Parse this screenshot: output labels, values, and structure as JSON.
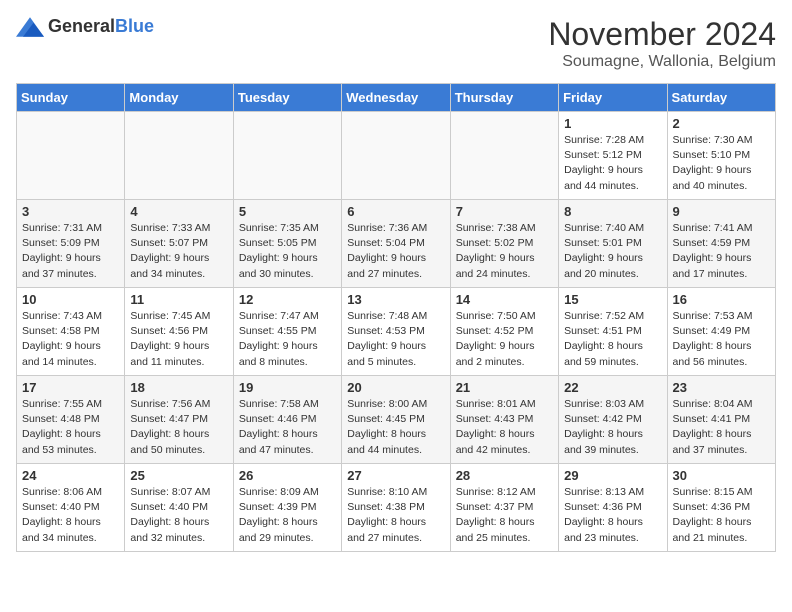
{
  "logo": {
    "text_general": "General",
    "text_blue": "Blue"
  },
  "title": "November 2024",
  "subtitle": "Soumagne, Wallonia, Belgium",
  "days_of_week": [
    "Sunday",
    "Monday",
    "Tuesday",
    "Wednesday",
    "Thursday",
    "Friday",
    "Saturday"
  ],
  "weeks": [
    [
      {
        "day": "",
        "info": ""
      },
      {
        "day": "",
        "info": ""
      },
      {
        "day": "",
        "info": ""
      },
      {
        "day": "",
        "info": ""
      },
      {
        "day": "",
        "info": ""
      },
      {
        "day": "1",
        "info": "Sunrise: 7:28 AM\nSunset: 5:12 PM\nDaylight: 9 hours and 44 minutes."
      },
      {
        "day": "2",
        "info": "Sunrise: 7:30 AM\nSunset: 5:10 PM\nDaylight: 9 hours and 40 minutes."
      }
    ],
    [
      {
        "day": "3",
        "info": "Sunrise: 7:31 AM\nSunset: 5:09 PM\nDaylight: 9 hours and 37 minutes."
      },
      {
        "day": "4",
        "info": "Sunrise: 7:33 AM\nSunset: 5:07 PM\nDaylight: 9 hours and 34 minutes."
      },
      {
        "day": "5",
        "info": "Sunrise: 7:35 AM\nSunset: 5:05 PM\nDaylight: 9 hours and 30 minutes."
      },
      {
        "day": "6",
        "info": "Sunrise: 7:36 AM\nSunset: 5:04 PM\nDaylight: 9 hours and 27 minutes."
      },
      {
        "day": "7",
        "info": "Sunrise: 7:38 AM\nSunset: 5:02 PM\nDaylight: 9 hours and 24 minutes."
      },
      {
        "day": "8",
        "info": "Sunrise: 7:40 AM\nSunset: 5:01 PM\nDaylight: 9 hours and 20 minutes."
      },
      {
        "day": "9",
        "info": "Sunrise: 7:41 AM\nSunset: 4:59 PM\nDaylight: 9 hours and 17 minutes."
      }
    ],
    [
      {
        "day": "10",
        "info": "Sunrise: 7:43 AM\nSunset: 4:58 PM\nDaylight: 9 hours and 14 minutes."
      },
      {
        "day": "11",
        "info": "Sunrise: 7:45 AM\nSunset: 4:56 PM\nDaylight: 9 hours and 11 minutes."
      },
      {
        "day": "12",
        "info": "Sunrise: 7:47 AM\nSunset: 4:55 PM\nDaylight: 9 hours and 8 minutes."
      },
      {
        "day": "13",
        "info": "Sunrise: 7:48 AM\nSunset: 4:53 PM\nDaylight: 9 hours and 5 minutes."
      },
      {
        "day": "14",
        "info": "Sunrise: 7:50 AM\nSunset: 4:52 PM\nDaylight: 9 hours and 2 minutes."
      },
      {
        "day": "15",
        "info": "Sunrise: 7:52 AM\nSunset: 4:51 PM\nDaylight: 8 hours and 59 minutes."
      },
      {
        "day": "16",
        "info": "Sunrise: 7:53 AM\nSunset: 4:49 PM\nDaylight: 8 hours and 56 minutes."
      }
    ],
    [
      {
        "day": "17",
        "info": "Sunrise: 7:55 AM\nSunset: 4:48 PM\nDaylight: 8 hours and 53 minutes."
      },
      {
        "day": "18",
        "info": "Sunrise: 7:56 AM\nSunset: 4:47 PM\nDaylight: 8 hours and 50 minutes."
      },
      {
        "day": "19",
        "info": "Sunrise: 7:58 AM\nSunset: 4:46 PM\nDaylight: 8 hours and 47 minutes."
      },
      {
        "day": "20",
        "info": "Sunrise: 8:00 AM\nSunset: 4:45 PM\nDaylight: 8 hours and 44 minutes."
      },
      {
        "day": "21",
        "info": "Sunrise: 8:01 AM\nSunset: 4:43 PM\nDaylight: 8 hours and 42 minutes."
      },
      {
        "day": "22",
        "info": "Sunrise: 8:03 AM\nSunset: 4:42 PM\nDaylight: 8 hours and 39 minutes."
      },
      {
        "day": "23",
        "info": "Sunrise: 8:04 AM\nSunset: 4:41 PM\nDaylight: 8 hours and 37 minutes."
      }
    ],
    [
      {
        "day": "24",
        "info": "Sunrise: 8:06 AM\nSunset: 4:40 PM\nDaylight: 8 hours and 34 minutes."
      },
      {
        "day": "25",
        "info": "Sunrise: 8:07 AM\nSunset: 4:40 PM\nDaylight: 8 hours and 32 minutes."
      },
      {
        "day": "26",
        "info": "Sunrise: 8:09 AM\nSunset: 4:39 PM\nDaylight: 8 hours and 29 minutes."
      },
      {
        "day": "27",
        "info": "Sunrise: 8:10 AM\nSunset: 4:38 PM\nDaylight: 8 hours and 27 minutes."
      },
      {
        "day": "28",
        "info": "Sunrise: 8:12 AM\nSunset: 4:37 PM\nDaylight: 8 hours and 25 minutes."
      },
      {
        "day": "29",
        "info": "Sunrise: 8:13 AM\nSunset: 4:36 PM\nDaylight: 8 hours and 23 minutes."
      },
      {
        "day": "30",
        "info": "Sunrise: 8:15 AM\nSunset: 4:36 PM\nDaylight: 8 hours and 21 minutes."
      }
    ]
  ]
}
